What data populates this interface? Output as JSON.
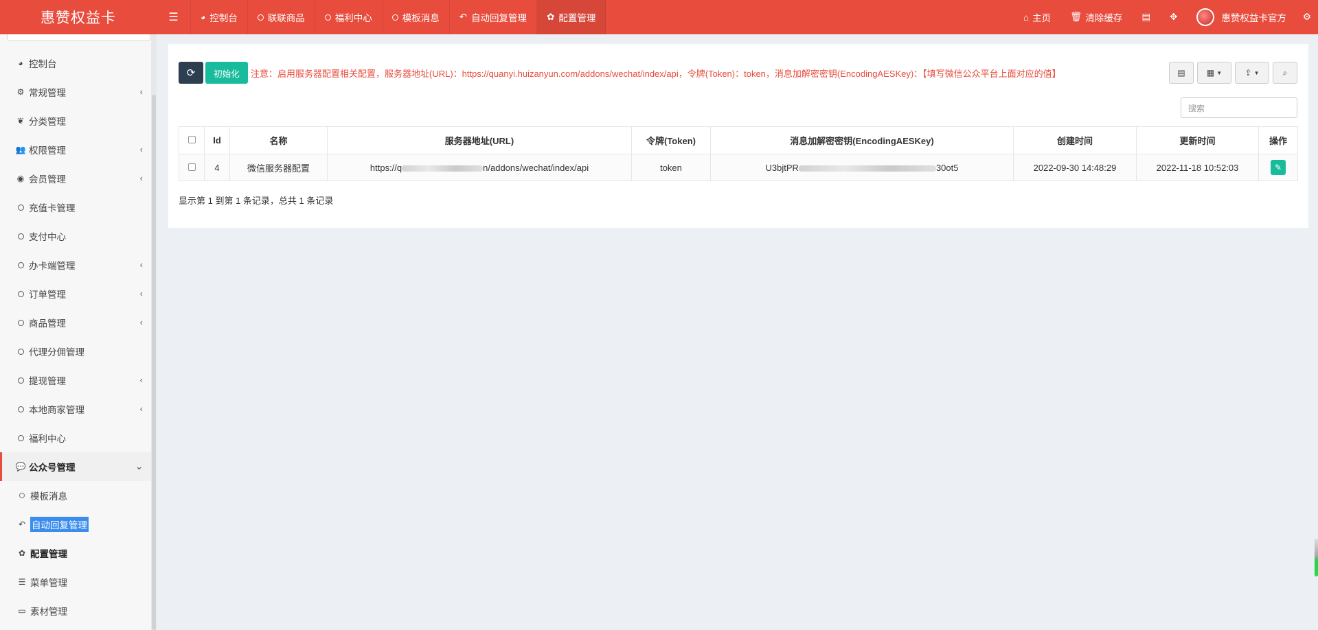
{
  "brand": "惠赞权益卡",
  "topnav": {
    "items": [
      {
        "label": "控制台",
        "icon": "dashboard-icon"
      },
      {
        "label": "联联商品",
        "icon": "circle-icon"
      },
      {
        "label": "福利中心",
        "icon": "circle-icon"
      },
      {
        "label": "模板消息",
        "icon": "circle-icon"
      },
      {
        "label": "自动回复管理",
        "icon": "reply-icon"
      },
      {
        "label": "配置管理",
        "icon": "gear-icon",
        "active": true
      }
    ]
  },
  "topright": {
    "home": "主页",
    "clear_cache": "清除缓存",
    "user": "惠赞权益卡官方"
  },
  "sidebar": {
    "items": [
      {
        "label": "控制台",
        "icon": "dashboard-icon"
      },
      {
        "label": "常规管理",
        "icon": "cogs-icon",
        "chevron": true
      },
      {
        "label": "分类管理",
        "icon": "leaf-icon"
      },
      {
        "label": "权限管理",
        "icon": "users-icon",
        "chevron": true
      },
      {
        "label": "会员管理",
        "icon": "user-circle-icon",
        "chevron": true
      },
      {
        "label": "充值卡管理",
        "icon": "circle-icon"
      },
      {
        "label": "支付中心",
        "icon": "circle-icon"
      },
      {
        "label": "办卡端管理",
        "icon": "circle-icon",
        "chevron": true
      },
      {
        "label": "订单管理",
        "icon": "circle-icon",
        "chevron": true
      },
      {
        "label": "商品管理",
        "icon": "circle-icon",
        "chevron": true
      },
      {
        "label": "代理分佣管理",
        "icon": "circle-icon"
      },
      {
        "label": "提现管理",
        "icon": "circle-icon",
        "chevron": true
      },
      {
        "label": "本地商家管理",
        "icon": "circle-icon",
        "chevron": true
      },
      {
        "label": "福利中心",
        "icon": "circle-icon"
      },
      {
        "label": "公众号管理",
        "icon": "wechat-icon",
        "open": true
      },
      {
        "label": "模板消息",
        "icon": "circle-icon",
        "sub": true
      },
      {
        "label": "自动回复管理",
        "icon": "reply-icon",
        "sub": true
      },
      {
        "label": "配置管理",
        "icon": "gear-icon",
        "sub": true,
        "current": true
      },
      {
        "label": "菜单管理",
        "icon": "list-icon",
        "sub": true
      },
      {
        "label": "素材管理",
        "icon": "image-icon",
        "sub": true
      }
    ]
  },
  "toolbar": {
    "init_label": "初始化",
    "notice": "注意：启用服务器配置相关配置，服务器地址(URL)：https://quanyi.huizanyun.com/addons/wechat/index/api，令牌(Token)：token，消息加解密密钥(EncodingAESKey)：【填写微信公众平台上面对应的值】",
    "search_placeholder": "搜索"
  },
  "table": {
    "headers": [
      "Id",
      "名称",
      "服务器地址(URL)",
      "令牌(Token)",
      "消息加解密密钥(EncodingAESKey)",
      "创建时间",
      "更新时间",
      "操作"
    ],
    "rows": [
      {
        "id": "4",
        "name": "微信服务器配置",
        "url_prefix": "https://q",
        "url_suffix": "n/addons/wechat/index/api",
        "token": "token",
        "aes_prefix": "U3bjtPR",
        "aes_suffix": "30ot5",
        "created": "2022-09-30 14:48:29",
        "updated": "2022-11-18 10:52:03"
      }
    ]
  },
  "footer": "显示第 1 到第 1 条记录，总共 1 条记录",
  "colors": {
    "topbar": "#e84c3d",
    "notice": "#e74c3c",
    "success": "#18bc9c",
    "dark": "#2c3e50"
  }
}
